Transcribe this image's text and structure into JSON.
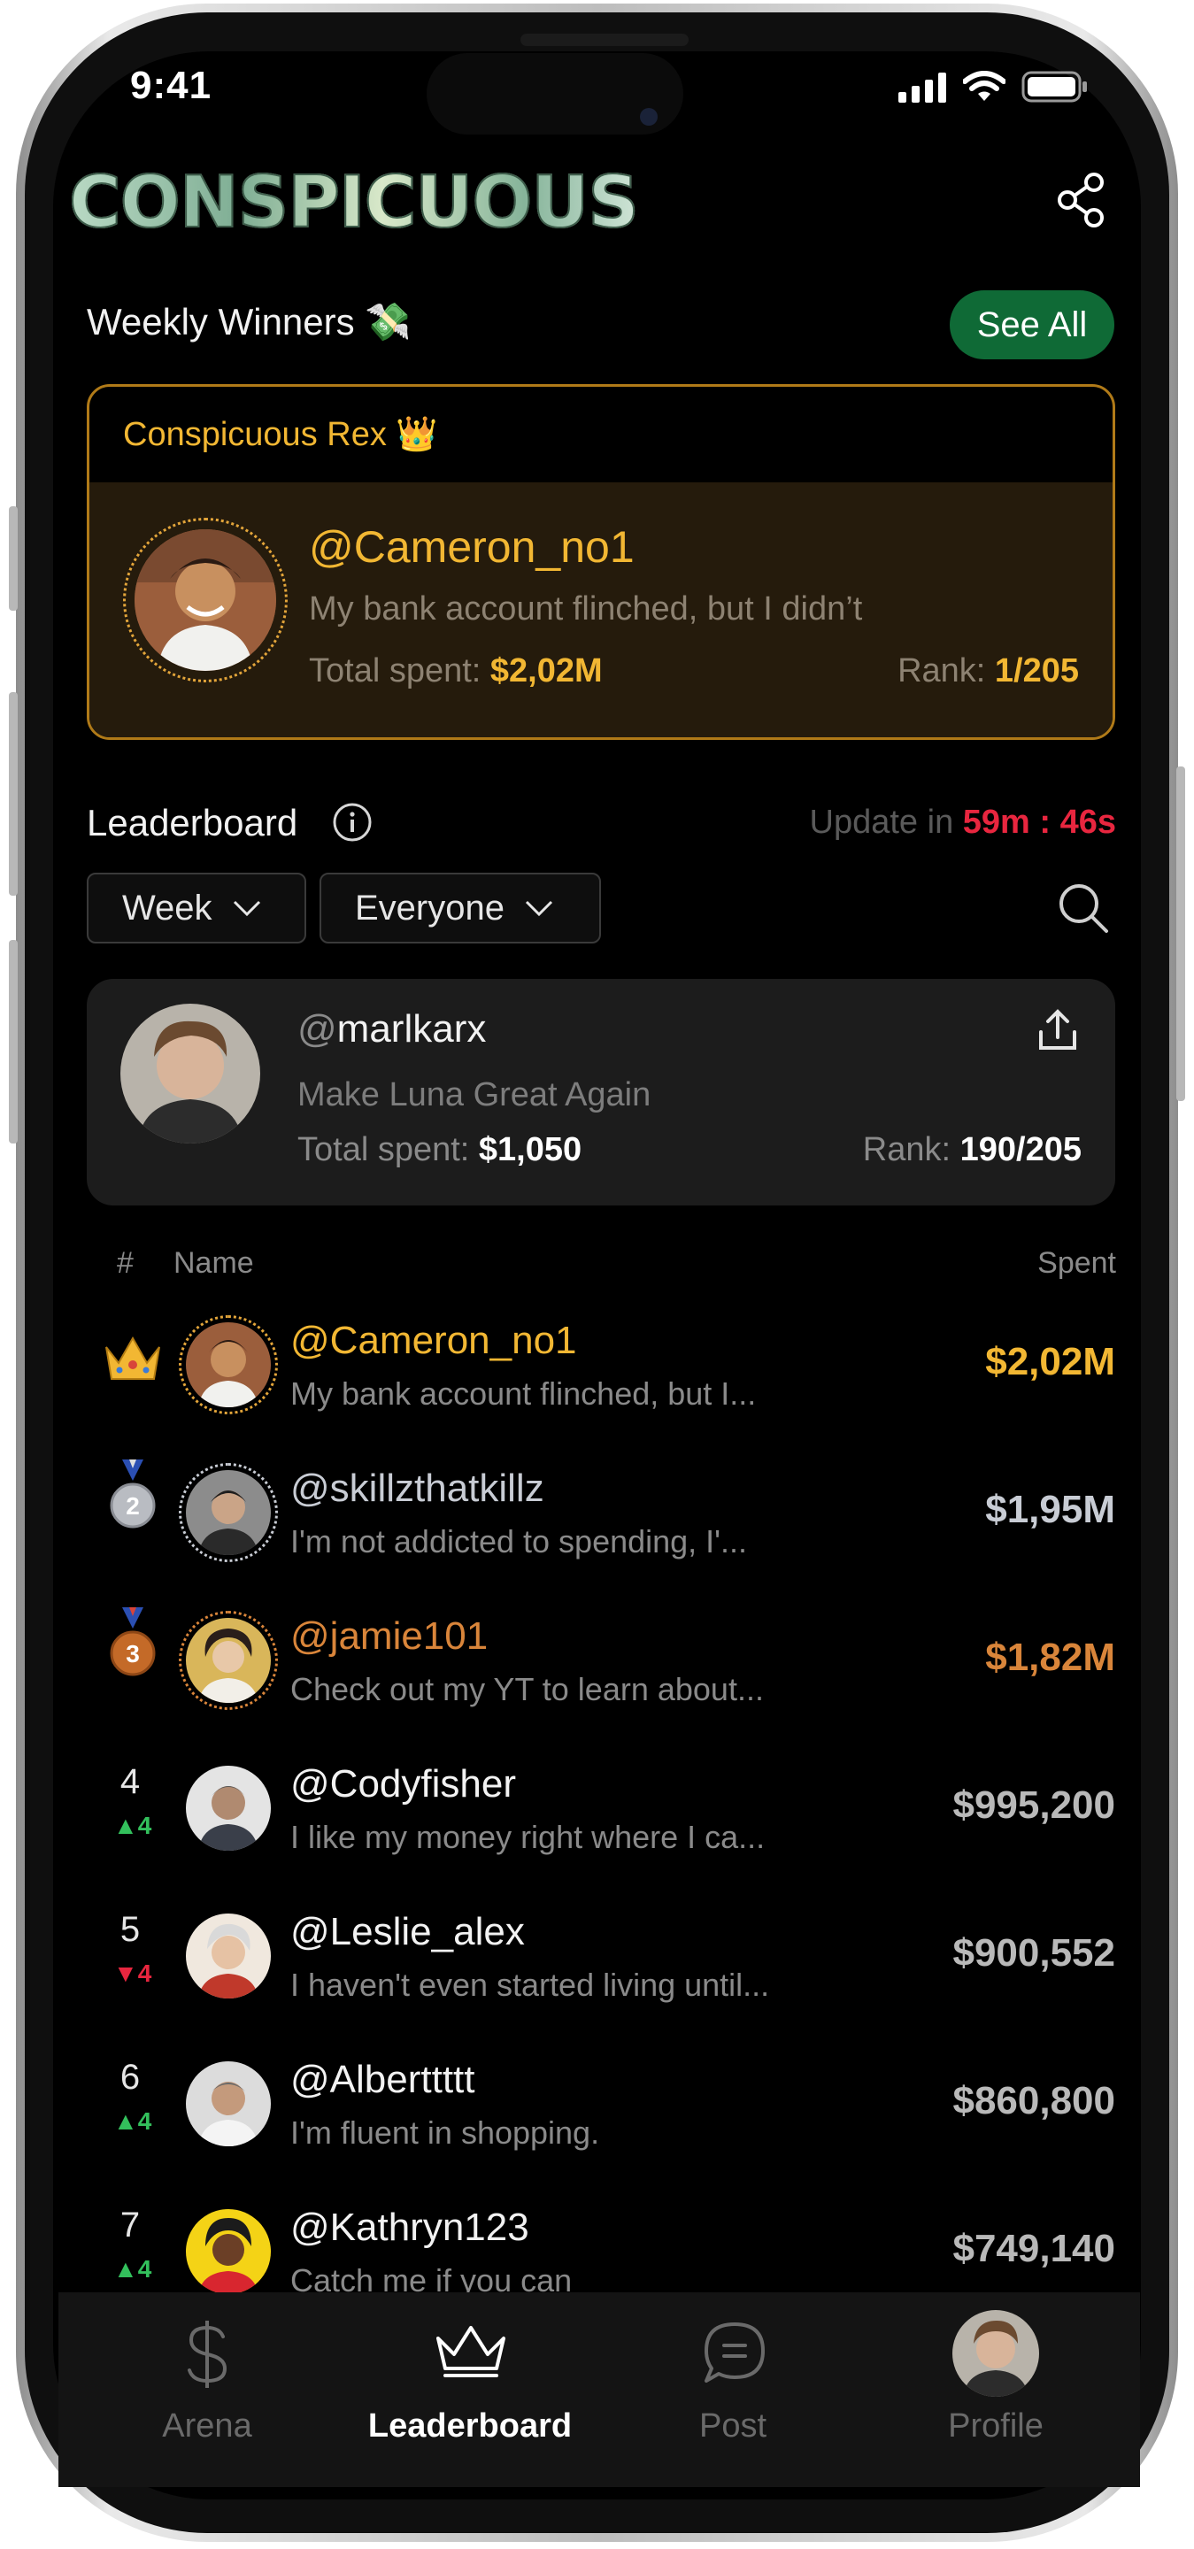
{
  "status_bar": {
    "time": "9:41"
  },
  "header": {
    "logo": "CONSPICUOUS"
  },
  "weekly_winners": {
    "title": "Weekly Winners",
    "emoji": "💸",
    "see_all": "See All",
    "card": {
      "label": "Conspicuous Rex",
      "label_emoji": "👑",
      "username": "@Cameron_no1",
      "bio": "My bank account flinched, but I didn’t",
      "spent_label": "Total spent:",
      "spent_value": "$2,02M",
      "rank_label": "Rank:",
      "rank_value": "1/205"
    }
  },
  "leaderboard": {
    "title": "Leaderboard",
    "update_label": "Update in",
    "update_time": "59m : 46s",
    "filters": {
      "period": "Week",
      "audience": "Everyone"
    },
    "my_card": {
      "at": "@",
      "username": "marlkarx",
      "bio": "Make Luna Great Again",
      "spent_label": "Total spent:",
      "spent_value": "$1,050",
      "rank_label": "Rank:",
      "rank_value": "190/205"
    },
    "columns": {
      "rank": "#",
      "name": "Name",
      "spent": "Spent"
    },
    "rows": [
      {
        "rank": "",
        "change": "",
        "trend": "",
        "username": "@Cameron_no1",
        "bio": "My bank account flinched, but I...",
        "spent": "$2,02M"
      },
      {
        "rank": "2",
        "change": "",
        "trend": "",
        "username": "@skillzthatkillz",
        "bio": "I'm not addicted to spending, I'...",
        "spent": "$1,95M"
      },
      {
        "rank": "3",
        "change": "",
        "trend": "",
        "username": "@jamie101",
        "bio": "Check out my YT to learn about...",
        "spent": "$1,82M"
      },
      {
        "rank": "4",
        "change": "4",
        "trend": "up",
        "username": "@Codyfisher",
        "bio": "I like my money right where I ca...",
        "spent": "$995,200"
      },
      {
        "rank": "5",
        "change": "4",
        "trend": "down",
        "username": "@Leslie_alex",
        "bio": "I haven't even started living until...",
        "spent": "$900,552"
      },
      {
        "rank": "6",
        "change": "4",
        "trend": "up",
        "username": "@Alberttttt",
        "bio": "I'm fluent in shopping.",
        "spent": "$860,800"
      },
      {
        "rank": "7",
        "change": "4",
        "trend": "up",
        "username": "@Kathryn123",
        "bio": "Catch me if you can",
        "spent": "$749,140"
      }
    ]
  },
  "tabbar": {
    "tabs": [
      {
        "label": "Arena",
        "icon": "dollar-icon",
        "active": false
      },
      {
        "label": "Leaderboard",
        "icon": "crown-icon",
        "active": true
      },
      {
        "label": "Post",
        "icon": "chat-bubble-icon",
        "active": false
      },
      {
        "label": "Profile",
        "icon": "avatar",
        "active": false
      }
    ]
  },
  "colors": {
    "gold": "#f2b733",
    "silver": "#c8ccd4",
    "bronze": "#d9853a",
    "accent_green": "#0f6a36",
    "timer_red": "#e8263f",
    "trend_up": "#33c05c",
    "trend_down": "#e8263f"
  }
}
